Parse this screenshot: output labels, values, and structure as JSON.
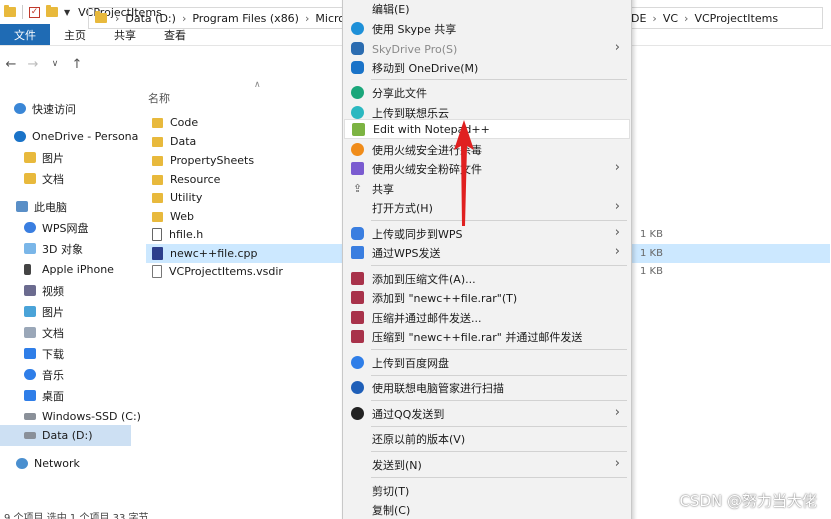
{
  "window": {
    "title": "VCProjectItems"
  },
  "ribbon": {
    "tabs": [
      "文件",
      "主页",
      "共享",
      "查看"
    ]
  },
  "address": {
    "crumbs": [
      "Data (D:)",
      "Program Files (x86)",
      "Microso"
    ],
    "tail": [
      "DE",
      "VC",
      "VCProjectItems"
    ]
  },
  "sidebar": {
    "items": [
      "快速访问",
      "OneDrive - Persona",
      "图片",
      "文档",
      "此电脑",
      "WPS网盘",
      "3D 对象",
      "Apple iPhone",
      "视频",
      "图片",
      "文档",
      "下载",
      "音乐",
      "桌面",
      "Windows-SSD (C:)",
      "Data (D:)",
      "Network"
    ],
    "selected": "Data (D:)"
  },
  "files": {
    "column_name": "名称",
    "items": [
      {
        "name": "Code",
        "type": "folder"
      },
      {
        "name": "Data",
        "type": "folder"
      },
      {
        "name": "PropertySheets",
        "type": "folder"
      },
      {
        "name": "Resource",
        "type": "folder"
      },
      {
        "name": "Utility",
        "type": "folder"
      },
      {
        "name": "Web",
        "type": "folder"
      },
      {
        "name": "hfile.h",
        "type": "h",
        "size": "1 KB"
      },
      {
        "name": "newc++file.cpp",
        "type": "cpp",
        "size": "1 KB",
        "selected": true
      },
      {
        "name": "VCProjectItems.vsdir",
        "type": "doc",
        "size": "1 KB"
      }
    ]
  },
  "status": {
    "text": "9 个项目    选中 1 个项目  33 字节"
  },
  "context_menu": {
    "items": [
      {
        "label": "编辑(E)"
      },
      {
        "label": "使用 Skype 共享",
        "icon_color": "#1e90d8"
      },
      {
        "label": "SkyDrive Pro(S)",
        "disabled": true,
        "submenu": true,
        "icon_color": "#2b6cb0"
      },
      {
        "label": "移动到 OneDrive(M)",
        "icon_color": "#1a73c8"
      },
      {
        "label": "分享此文件",
        "icon_color": "#1aa67a"
      },
      {
        "label": "上传到联想乐云",
        "icon_color": "#2bb8c0"
      },
      {
        "label": "Edit with Notepad++",
        "highlight": true,
        "icon_color": "#7cb342"
      },
      {
        "label": "使用火绒安全进行杀毒",
        "icon_color": "#f08c1a"
      },
      {
        "label": "使用火绒安全粉碎文件",
        "submenu": true,
        "icon_color": "#7a5bd0"
      },
      {
        "label": "共享",
        "icon_color": "#555555"
      },
      {
        "label": "打开方式(H)",
        "submenu": true
      },
      {
        "label": "上传或同步到WPS",
        "submenu": true,
        "icon_color": "#3a7ee0"
      },
      {
        "label": "通过WPS发送",
        "submenu": true,
        "icon_color": "#3a7ee0"
      },
      {
        "label": "添加到压缩文件(A)...",
        "icon_color": "#a8324a"
      },
      {
        "label": "添加到 \"newc++file.rar\"(T)",
        "icon_color": "#a8324a"
      },
      {
        "label": "压缩并通过邮件发送...",
        "icon_color": "#a8324a"
      },
      {
        "label": "压缩到 \"newc++file.rar\" 并通过邮件发送",
        "icon_color": "#a8324a"
      },
      {
        "label": "上传到百度网盘",
        "icon_color": "#2f7ee8"
      },
      {
        "label": "使用联想电脑管家进行扫描",
        "icon_color": "#1f5fb8"
      },
      {
        "label": "通过QQ发送到",
        "submenu": true,
        "icon_color": "#222222"
      },
      {
        "label": "还原以前的版本(V)"
      },
      {
        "label": "发送到(N)",
        "submenu": true
      },
      {
        "label": "剪切(T)"
      },
      {
        "label": "复制(C)"
      }
    ]
  },
  "watermark": "CSDN @努力当大佬",
  "colors": {
    "accent": "#1f6bb4",
    "selection": "#cce8ff",
    "arrow": "#e02020"
  }
}
